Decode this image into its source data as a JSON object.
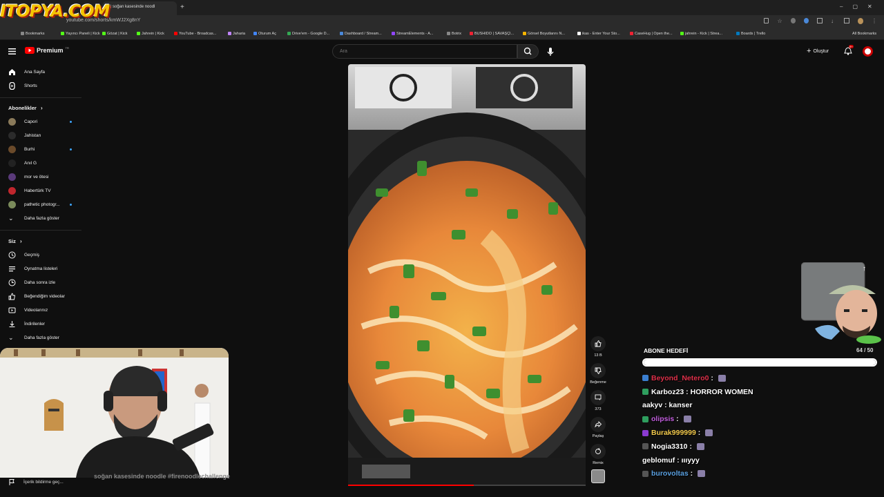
{
  "browser": {
    "tab_title": "(1) soğan kasesinde noodl",
    "url": "youtube.com/shorts/kmWJ2Xg8nY",
    "bookmarks": [
      "Bookmarks",
      "Yayıncı Paneli | Kick",
      "Gözat | Kick",
      "Jahrein | Kick",
      "YouTube - Broadcas...",
      "Jaharia",
      "Oturum Aç",
      "Drive'em - Google D...",
      "Dashboard / Stream...",
      "StreamElements - A...",
      "Botrix",
      "BUSHIDO | SAVAŞÇI...",
      "Görsel Boyutlarını N...",
      "ikas - Enter Your Sto...",
      "CaseHug | Open the...",
      "jahrein - Kick | Strea...",
      "Boards | Trello"
    ],
    "all_bookmarks": "All Bookmarks",
    "overlay_logo": "ITOPYA.COM"
  },
  "youtube": {
    "brand": "Premium",
    "brand_sup": "TR",
    "search_placeholder": "Ara",
    "create_label": "Oluştur",
    "notif_badge": "9+"
  },
  "sidebar": {
    "home": "Ana Sayfa",
    "shorts": "Shorts",
    "subs_title": "Abonelikler",
    "subs": [
      {
        "name": "Capori",
        "color": "#8a7a5a",
        "dot": true
      },
      {
        "name": "Jahistan",
        "color": "#2b2b2b",
        "dot": false
      },
      {
        "name": "Burhi",
        "color": "#6a4a2a",
        "dot": true
      },
      {
        "name": "Anıl G",
        "color": "#222222",
        "dot": false
      },
      {
        "name": "mor ve ötesi",
        "color": "#5a3a7a",
        "dot": false
      },
      {
        "name": "Habertürk TV",
        "color": "#c0262d",
        "dot": false
      },
      {
        "name": "pathetic photogr...",
        "color": "#7a8a5a",
        "dot": true
      }
    ],
    "show_more": "Daha fazla göster",
    "you_title": "Siz",
    "you": [
      "Geçmiş",
      "Oynatma listeleri",
      "Daha sonra izle",
      "Beğendiğim videolar",
      "Videolarınız",
      "İndirilenler"
    ],
    "show_more2": "Daha fazla göster",
    "report": "İçerik bildirme geç..."
  },
  "short": {
    "likes": "13 B",
    "dislike_label": "Beğenme",
    "comments": "373",
    "share_label": "Paylaş",
    "remix_label": "Remix",
    "caption": "soğan kasesinde noodle #firenoodlechallenge",
    "progress": 0.53
  },
  "stream": {
    "goal_title": "ABONE HEDEFİ",
    "goal_count": "64 / 50",
    "goal_progress": 1.0,
    "chat": [
      {
        "user": "Beyond_Netero0",
        "text": "",
        "user_color": "#e0304a",
        "badge": "#3b7fd0",
        "emote": true
      },
      {
        "user": "Karboz23",
        "text": "HORROR WOMEN",
        "user_color": "#ffffff",
        "badge": "#2e9e5e",
        "emote": false
      },
      {
        "user": "aakyv",
        "text": "kanser",
        "user_color": "#ffffff",
        "badge": "",
        "emote": false
      },
      {
        "user": "olipsis",
        "text": "",
        "user_color": "#c45fe0",
        "badge": "#2e9e5e",
        "emote": true
      },
      {
        "user": "Burak999999",
        "text": "",
        "user_color": "#f2c94c",
        "badge": "#8a3ad0",
        "emote": true
      },
      {
        "user": "Nogia3310",
        "text": "",
        "user_color": "#ffffff",
        "badge": "#555555",
        "emote": true
      },
      {
        "user": "geblomuf",
        "text": "ıııyyy",
        "user_color": "#ffffff",
        "badge": "",
        "emote": false
      },
      {
        "user": "burovoltas",
        "text": "",
        "user_color": "#5aa0e0",
        "badge": "#555555",
        "emote": true
      }
    ]
  }
}
